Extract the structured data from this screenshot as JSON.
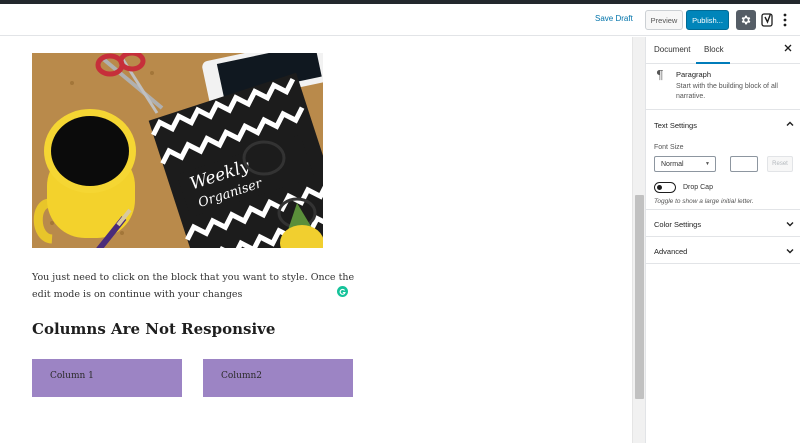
{
  "toolbar": {
    "save_draft_label": "Save Draft",
    "preview_label": "Preview",
    "publish_label": "Publish...",
    "publish_color": "#0085ba"
  },
  "editor": {
    "paragraph_text": "You just need to click on the block that you want to style. Once the edit mode is on continue with your changes",
    "heading_text": "Columns Are Not Responsive",
    "columns": [
      "Column 1",
      "Column2"
    ],
    "column_color": "#9c84c4",
    "image_text": "Weekly Organiser"
  },
  "sidebar": {
    "tabs": [
      "Document",
      "Block"
    ],
    "active_tab": "Block",
    "block": {
      "title": "Paragraph",
      "description": "Start with the building block of all narrative."
    },
    "text_settings": {
      "header": "Text Settings",
      "font_size_label": "Font Size",
      "font_size_value": "Normal",
      "reset_label": "Reset",
      "drop_cap_label": "Drop Cap",
      "drop_cap_help": "Toggle to show a large initial letter."
    },
    "panels": [
      "Color Settings",
      "Advanced"
    ]
  }
}
